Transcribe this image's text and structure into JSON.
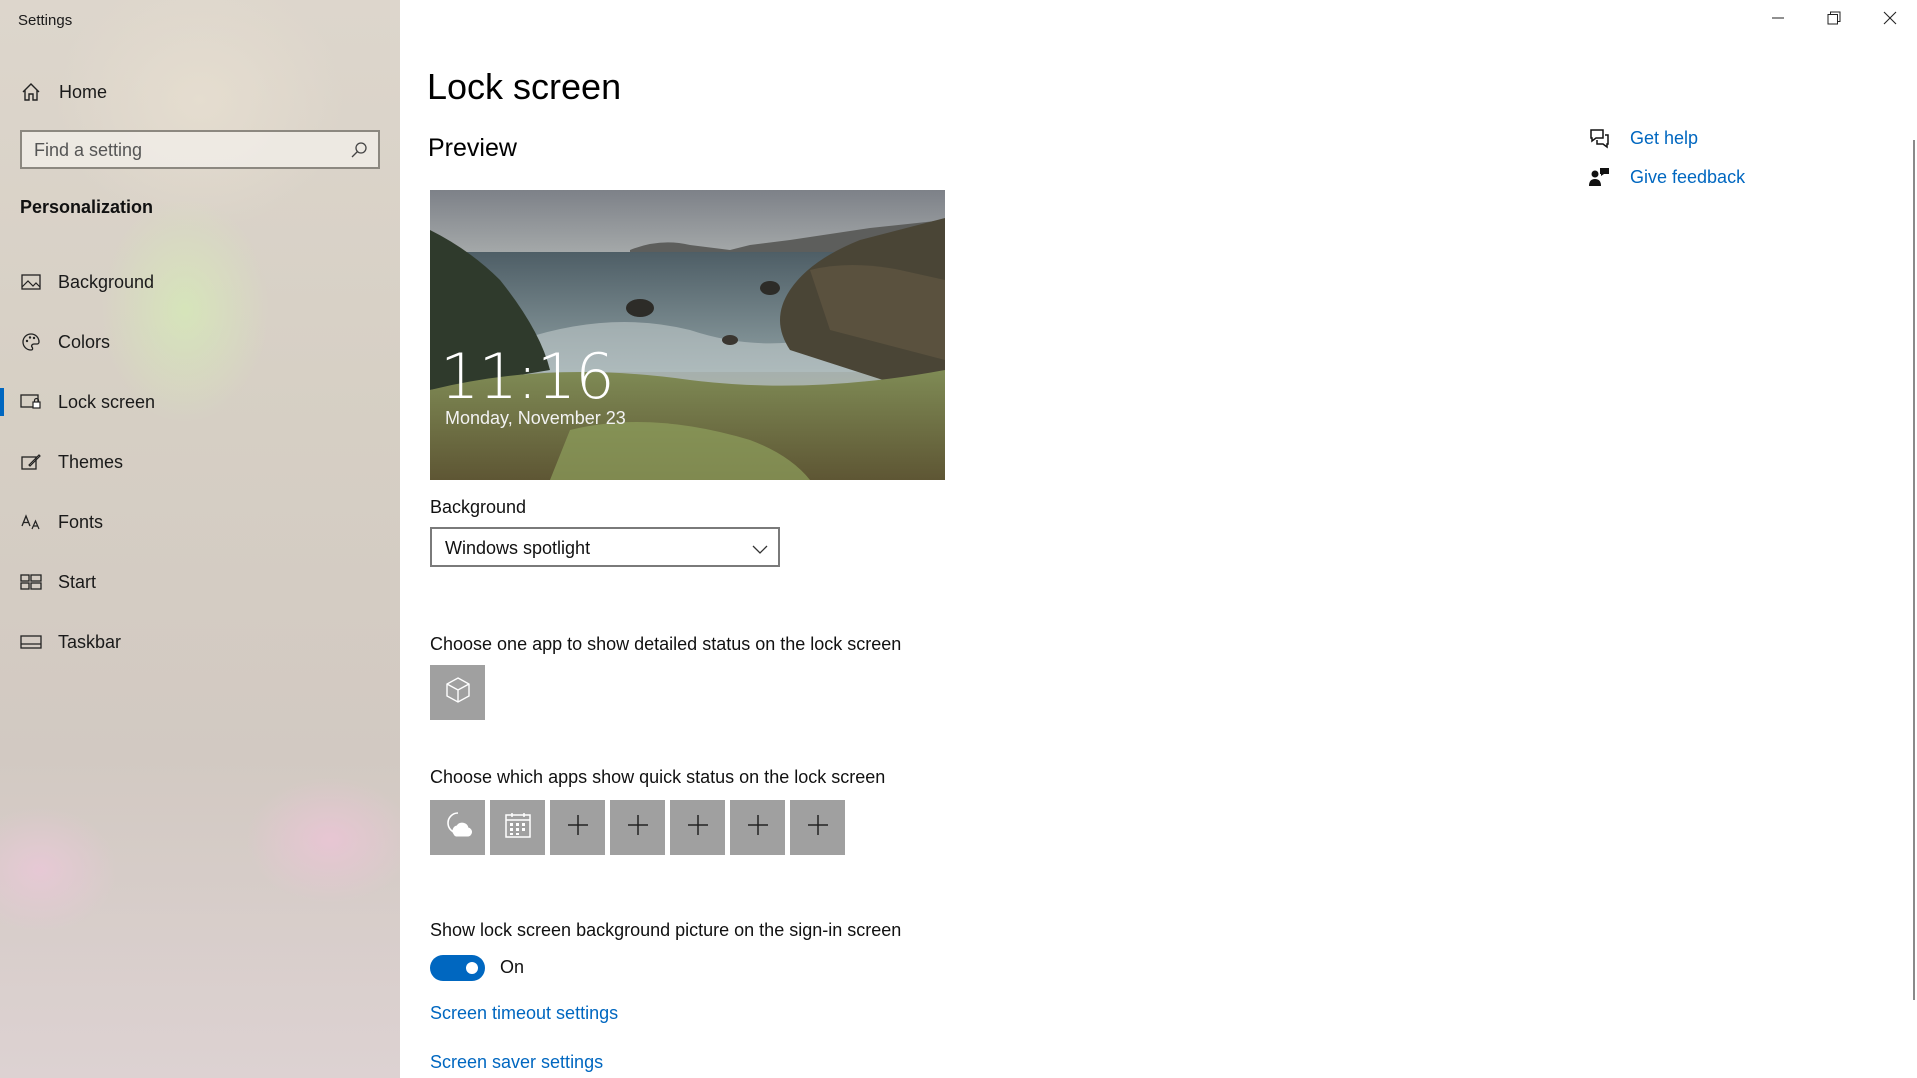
{
  "window": {
    "title": "Settings",
    "controls": {
      "minimize": "minimize",
      "restore": "restore",
      "close": "close"
    }
  },
  "sidebar": {
    "home_label": "Home",
    "search": {
      "placeholder": "Find a setting",
      "value": ""
    },
    "section_title": "Personalization",
    "items": [
      {
        "label": "Background",
        "icon": "picture-icon"
      },
      {
        "label": "Colors",
        "icon": "palette-icon"
      },
      {
        "label": "Lock screen",
        "icon": "lock-screen-icon",
        "active": true
      },
      {
        "label": "Themes",
        "icon": "themes-icon"
      },
      {
        "label": "Fonts",
        "icon": "fonts-icon"
      },
      {
        "label": "Start",
        "icon": "start-icon"
      },
      {
        "label": "Taskbar",
        "icon": "taskbar-icon"
      }
    ]
  },
  "main": {
    "title": "Lock screen",
    "preview_heading": "Preview",
    "preview": {
      "time": "11:16",
      "date": "Monday, November 23"
    },
    "background_label": "Background",
    "background_value": "Windows spotlight",
    "detailed_status_label": "Choose one app to show detailed status on the lock screen",
    "quick_status_label": "Choose which apps show quick status on the lock screen",
    "quick_status_tiles": [
      "weather-icon",
      "calendar-icon",
      "plus-icon",
      "plus-icon",
      "plus-icon",
      "plus-icon",
      "plus-icon"
    ],
    "signin_bg_label": "Show lock screen background picture on the sign-in screen",
    "signin_bg_toggle": "On",
    "timeout_link": "Screen timeout settings",
    "saver_link": "Screen saver settings"
  },
  "help": {
    "get_help": "Get help",
    "give_feedback": "Give feedback"
  },
  "colors": {
    "accent": "#0067c0",
    "tile_bg": "#a0a0a0"
  }
}
